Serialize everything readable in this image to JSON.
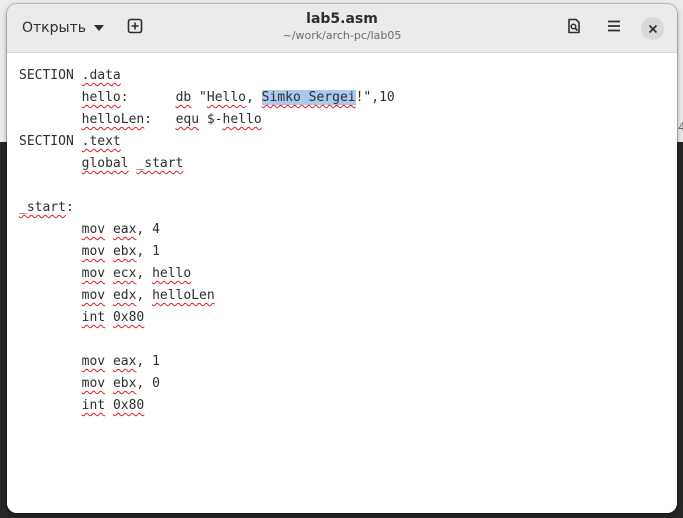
{
  "headerbar": {
    "open_label": "Открыть",
    "title": "lab5.asm",
    "subtitle": "~/work/arch-pc/lab05",
    "icons": [
      "chevron-down-icon",
      "new-tab-icon",
      "document-search-icon",
      "hamburger-menu-icon",
      "close-icon"
    ]
  },
  "background_peek": "34",
  "editor": {
    "lines": [
      [
        {
          "t": "SECTION"
        },
        {
          "t": " "
        },
        {
          "t": ".data",
          "sq": true
        }
      ],
      [
        {
          "t": "        "
        },
        {
          "t": "hello",
          "sq": true
        },
        {
          "t": ":      "
        },
        {
          "t": "db",
          "sq": true
        },
        {
          "t": " \""
        },
        {
          "t": "Hello",
          "sq": true
        },
        {
          "t": ", "
        },
        {
          "t": "Simko Sergei",
          "sq": true,
          "sel": true
        },
        {
          "t": "!\",10"
        }
      ],
      [
        {
          "t": "        "
        },
        {
          "t": "helloLen",
          "sq": true
        },
        {
          "t": ":   "
        },
        {
          "t": "equ",
          "sq": true
        },
        {
          "t": " $-"
        },
        {
          "t": "hello",
          "sq": true
        }
      ],
      [
        {
          "t": "SECTION"
        },
        {
          "t": " "
        },
        {
          "t": ".text",
          "sq": true
        }
      ],
      [
        {
          "t": "        "
        },
        {
          "t": "global",
          "sq": true
        },
        {
          "t": " "
        },
        {
          "t": "_start",
          "sq": true
        }
      ],
      [
        {
          "t": ""
        }
      ],
      [
        {
          "t": "_start",
          "sq": true
        },
        {
          "t": ":"
        }
      ],
      [
        {
          "t": "        "
        },
        {
          "t": "mov",
          "sq": true
        },
        {
          "t": " "
        },
        {
          "t": "eax",
          "sq": true
        },
        {
          "t": ", 4"
        }
      ],
      [
        {
          "t": "        "
        },
        {
          "t": "mov",
          "sq": true
        },
        {
          "t": " "
        },
        {
          "t": "ebx",
          "sq": true
        },
        {
          "t": ", 1"
        }
      ],
      [
        {
          "t": "        "
        },
        {
          "t": "mov",
          "sq": true
        },
        {
          "t": " "
        },
        {
          "t": "ecx",
          "sq": true
        },
        {
          "t": ", "
        },
        {
          "t": "hello",
          "sq": true
        }
      ],
      [
        {
          "t": "        "
        },
        {
          "t": "mov",
          "sq": true
        },
        {
          "t": " "
        },
        {
          "t": "edx",
          "sq": true
        },
        {
          "t": ", "
        },
        {
          "t": "helloLen",
          "sq": true
        }
      ],
      [
        {
          "t": "        "
        },
        {
          "t": "int",
          "sq": true
        },
        {
          "t": " "
        },
        {
          "t": "0x80",
          "sq": true
        }
      ],
      [
        {
          "t": ""
        }
      ],
      [
        {
          "t": "        "
        },
        {
          "t": "mov",
          "sq": true
        },
        {
          "t": " "
        },
        {
          "t": "eax",
          "sq": true
        },
        {
          "t": ", 1"
        }
      ],
      [
        {
          "t": "        "
        },
        {
          "t": "mov",
          "sq": true
        },
        {
          "t": " "
        },
        {
          "t": "ebx",
          "sq": true
        },
        {
          "t": ", 0"
        }
      ],
      [
        {
          "t": "        "
        },
        {
          "t": "int",
          "sq": true
        },
        {
          "t": " "
        },
        {
          "t": "0x80",
          "sq": true
        }
      ]
    ]
  },
  "colors": {
    "headerbar_bg": "#ebebeb",
    "text": "#2e2e2e",
    "spell_underline": "#e01b24",
    "selection": "#a9c9ef"
  }
}
